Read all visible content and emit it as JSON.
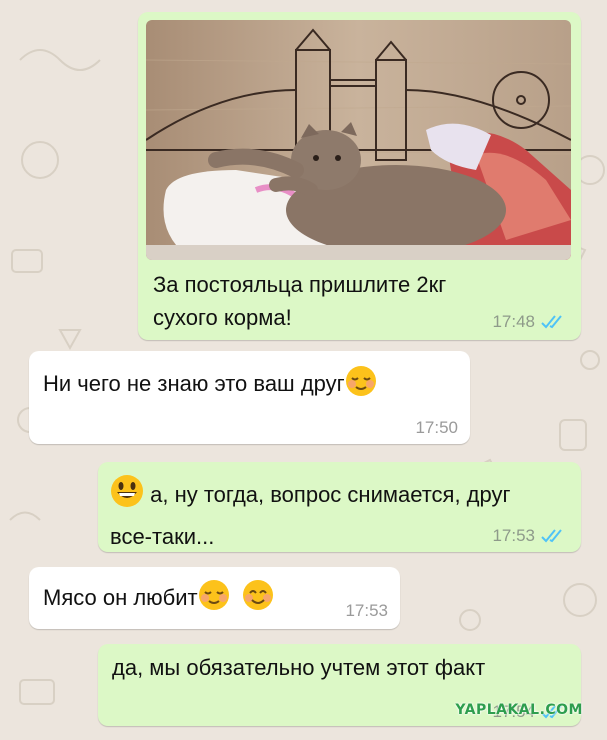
{
  "messages": [
    {
      "text": "За постояльца пришлите 2кг сухого корма!",
      "time": "17:48",
      "direction": "outgoing",
      "status": "read",
      "has_photo": true
    },
    {
      "text": "Ни чего не знаю это ваш друг",
      "time": "17:50",
      "direction": "incoming",
      "emoji_after": "relieved-face"
    },
    {
      "text": "а, ну тогда, вопрос снимается, друг все-таки...",
      "time": "17:53",
      "direction": "outgoing",
      "status": "read",
      "emoji_before": "grinning-face"
    },
    {
      "text": "Мясо он любит",
      "time": "17:53",
      "direction": "incoming",
      "emoji_after": [
        "relieved-face",
        "smiling-face"
      ]
    },
    {
      "text": "да, мы обязательно учтем этот факт",
      "time": "17:54",
      "direction": "outgoing",
      "status": "read"
    }
  ],
  "watermark": "YAPLAKAL.COM",
  "colors": {
    "background": "#ece5dd",
    "outgoing_bubble": "#dcf8c6",
    "incoming_bubble": "#ffffff",
    "read_ticks": "#4fc3f7"
  }
}
